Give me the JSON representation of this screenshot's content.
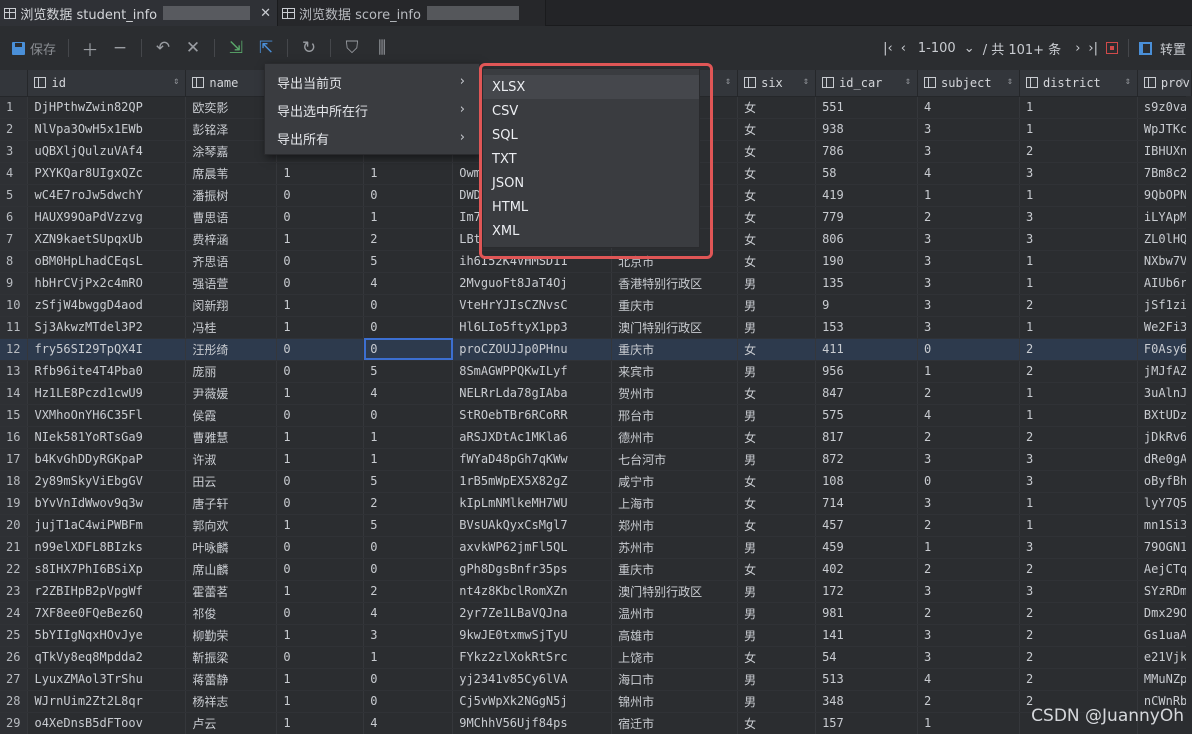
{
  "tabs": [
    {
      "label": "浏览数据 student_info",
      "active": true
    },
    {
      "label": "浏览数据 score_info",
      "active": false
    }
  ],
  "toolbar": {
    "save_label": "保存",
    "page_range": "1-100",
    "total": "/ 共 101+ 条",
    "transpose_label": "转置"
  },
  "columns": [
    "id",
    "name",
    "",
    "",
    "",
    "",
    "six",
    "id_car",
    "subject",
    "district",
    "prov"
  ],
  "context_menu": {
    "items": [
      "导出当前页",
      "导出选中所在行",
      "导出所有"
    ]
  },
  "export_formats": [
    "XLSX",
    "CSV",
    "SQL",
    "TXT",
    "JSON",
    "HTML",
    "XML"
  ],
  "rows": [
    [
      "1",
      "DjHPthwZwin82QP",
      "欧奕影",
      "",
      "",
      "",
      "",
      "女",
      "551",
      "4",
      "1",
      "s9z0va"
    ],
    [
      "2",
      "NlVpa3OwH5x1EWb",
      "彭铭泽",
      "",
      "",
      "",
      "",
      "女",
      "938",
      "3",
      "1",
      "WpJTKc"
    ],
    [
      "3",
      "uQBXljQulzuVAf4",
      "涂琴嘉",
      "",
      "",
      "",
      "",
      "女",
      "786",
      "3",
      "2",
      "IBHUXn"
    ],
    [
      "4",
      "PXYKQar8UIgxQZc",
      "席晨苇",
      "1",
      "1",
      "Owm",
      "",
      "女",
      "58",
      "4",
      "3",
      "7Bm8c2"
    ],
    [
      "5",
      "wC4E7roJw5dwchY",
      "潘振树",
      "0",
      "0",
      "DWD",
      "",
      "女",
      "419",
      "1",
      "1",
      "9QbOPN"
    ],
    [
      "6",
      "HAUX99OaPdVzzvg",
      "曹思语",
      "0",
      "1",
      "Im7",
      "",
      "女",
      "779",
      "2",
      "3",
      "iLYApM"
    ],
    [
      "7",
      "XZN9kaetSUpqxUb",
      "费梓涵",
      "1",
      "2",
      "LBt",
      "",
      "女",
      "806",
      "3",
      "3",
      "ZL0lHQ"
    ],
    [
      "8",
      "oBM0HpLhadCEqsL",
      "齐思语",
      "0",
      "5",
      "ih6I52K4VHMSD11",
      "北京市",
      "女",
      "190",
      "3",
      "1",
      "NXbw7V"
    ],
    [
      "9",
      "hbHrCVjPx2c4mRO",
      "强语萱",
      "0",
      "4",
      "2MvguoFt8JaT4Oj",
      "香港特别行政区",
      "男",
      "135",
      "3",
      "1",
      "AIUb6r"
    ],
    [
      "10",
      "zSfjW4bwggD4aod",
      "闵新翔",
      "1",
      "0",
      "VteHrYJIsCZNvsC",
      "重庆市",
      "男",
      "9",
      "3",
      "2",
      "jSf1zi"
    ],
    [
      "11",
      "Sj3AkwzMTdel3P2",
      "冯桂",
      "1",
      "0",
      "Hl6LIo5ftyX1pp3",
      "澳门特别行政区",
      "男",
      "153",
      "3",
      "1",
      "We2Fi3"
    ],
    [
      "12",
      "fry56SI29TpQX4I",
      "汪彤绮",
      "0",
      "0",
      "proCZOUJJp0PHnu",
      "重庆市",
      "女",
      "411",
      "0",
      "2",
      "F0Asy6"
    ],
    [
      "13",
      "Rfb96ite4T4Pba0",
      "庞丽",
      "0",
      "5",
      "8SmAGWPPQKwILyf",
      "来宾市",
      "男",
      "956",
      "1",
      "2",
      "jMJfAZ"
    ],
    [
      "14",
      "Hz1LE8Pczd1cwU9",
      "尹薇媛",
      "1",
      "4",
      "NELRrLda78gIAba",
      "贺州市",
      "女",
      "847",
      "2",
      "1",
      "3uAlnJ"
    ],
    [
      "15",
      "VXMhoOnYH6C35Fl",
      "侯霞",
      "0",
      "0",
      "StROebTBr6RCoRR",
      "邢台市",
      "男",
      "575",
      "4",
      "1",
      "BXtUDz"
    ],
    [
      "16",
      "NIek581YoRTsGa9",
      "曹雅慧",
      "1",
      "1",
      "aRSJXDtAc1MKla6",
      "德州市",
      "女",
      "817",
      "2",
      "2",
      "jDkRv6"
    ],
    [
      "17",
      "b4KvGhDDyRGKpaP",
      "许淑",
      "1",
      "1",
      "fWYaD48pGh7qKWw",
      "七台河市",
      "男",
      "872",
      "3",
      "3",
      "dRe0gA"
    ],
    [
      "18",
      "2y89mSkyViEbgGV",
      "田云",
      "0",
      "5",
      "1rB5mWpEX5X82gZ",
      "咸宁市",
      "女",
      "108",
      "0",
      "3",
      "oByfBh"
    ],
    [
      "19",
      "bYvVnIdWwov9q3w",
      "唐子轩",
      "0",
      "2",
      "kIpLmNMlkeMH7WU",
      "上海市",
      "女",
      "714",
      "3",
      "1",
      "lyY7Q5"
    ],
    [
      "20",
      "jujT1aC4wiPWBFm",
      "郭向欢",
      "1",
      "5",
      "BVsUAkQyxCsMgl7",
      "郑州市",
      "女",
      "457",
      "2",
      "1",
      "mn1Si3"
    ],
    [
      "21",
      "n99elXDFL8BIzks",
      "叶咏麟",
      "0",
      "0",
      "axvkWP62jmFl5QL",
      "苏州市",
      "男",
      "459",
      "1",
      "3",
      "79OGN1"
    ],
    [
      "22",
      "s8IHX7PhI6BSiXp",
      "席山麟",
      "0",
      "0",
      "gPh8DgsBnfr35ps",
      "重庆市",
      "女",
      "402",
      "2",
      "2",
      "AejCTq"
    ],
    [
      "23",
      "r2ZBIHpB2pVpgWf",
      "霍蕾茗",
      "1",
      "2",
      "nt4z8KbclRomXZn",
      "澳门特别行政区",
      "男",
      "172",
      "3",
      "3",
      "SYzRDm"
    ],
    [
      "24",
      "7XF8ee0FQeBez6Q",
      "祁俊",
      "0",
      "4",
      "2yr7Ze1LBaVQJna",
      "温州市",
      "男",
      "981",
      "2",
      "2",
      "Dmx29O"
    ],
    [
      "25",
      "5bYIIgNqxHOvJye",
      "柳勤荣",
      "1",
      "3",
      "9kwJE0txmwSjTyU",
      "高雄市",
      "男",
      "141",
      "3",
      "2",
      "Gs1uaA"
    ],
    [
      "26",
      "qTkVy8eq8Mpdda2",
      "靳振梁",
      "0",
      "1",
      "FYkz2zlXokRtSrc",
      "上饶市",
      "女",
      "54",
      "3",
      "2",
      "e21Vjk"
    ],
    [
      "27",
      "LyuxZMAol3TrShu",
      "蒋蕾静",
      "1",
      "0",
      "yj2341v85Cy6lVA",
      "海口市",
      "男",
      "513",
      "4",
      "2",
      "MMuNZp"
    ],
    [
      "28",
      "WJrnUim2Zt2L8qr",
      "杨祥志",
      "1",
      "0",
      "Cj5vWpXk2NGgN5j",
      "锦州市",
      "男",
      "348",
      "2",
      "2",
      "nCWnRb"
    ],
    [
      "29",
      "o4XeDnsB5dFToov",
      "卢云",
      "1",
      "4",
      "9MChhV56Ujf84ps",
      "宿迁市",
      "女",
      "157",
      "1",
      "",
      ""
    ]
  ],
  "watermark": "CSDN @JuannyOh"
}
